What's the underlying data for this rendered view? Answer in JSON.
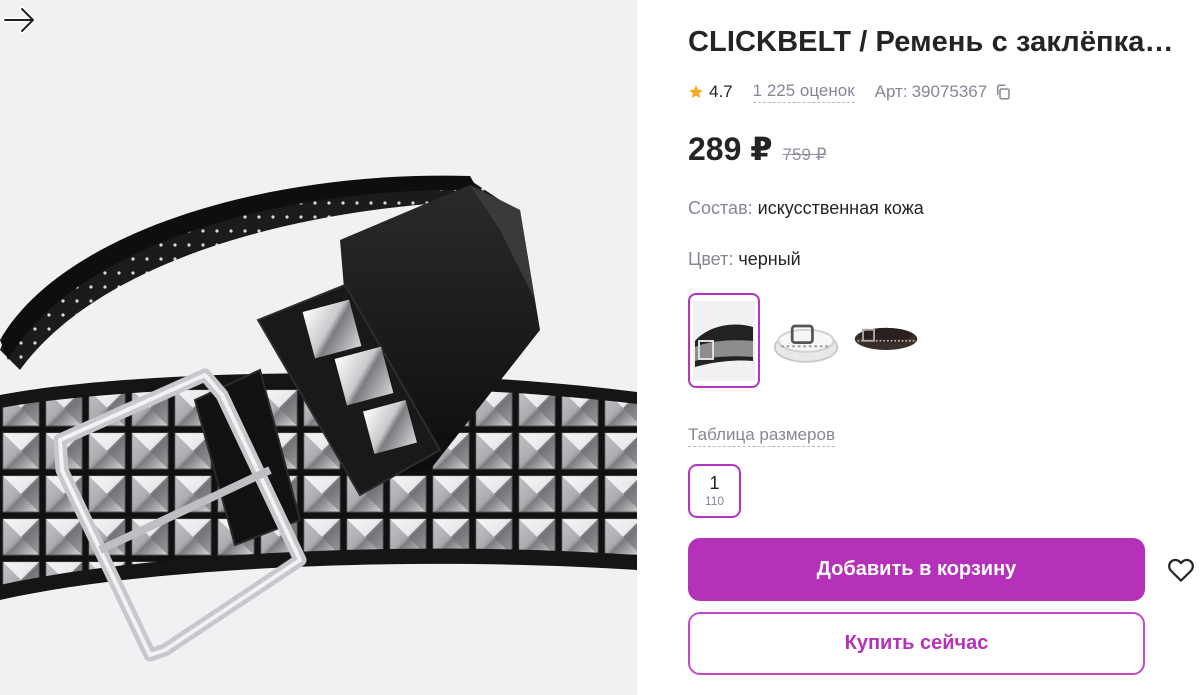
{
  "product": {
    "title": "CLICKBELT / Ремень с заклёпкам...",
    "rating": "4.7",
    "reviews": "1 225 оценок",
    "article_label": "Арт:",
    "article_value": "39075367",
    "price_current": "289 ₽",
    "price_old": "759 ₽"
  },
  "attributes": {
    "composition_label": "Состав:",
    "composition_value": "искусственная кожа",
    "color_label": "Цвет:",
    "color_value": "черный"
  },
  "color_options": [
    {
      "name": "черный",
      "selected": true
    },
    {
      "name": "белый",
      "selected": false
    },
    {
      "name": "коричневый",
      "selected": false
    }
  ],
  "sizes": {
    "table_link": "Таблица размеров",
    "options": [
      {
        "label": "1",
        "sub": "110",
        "selected": true
      }
    ]
  },
  "actions": {
    "add_to_cart": "Добавить в корзину",
    "buy_now": "Купить сейчас"
  },
  "icons": {
    "rating": "star-icon",
    "copy": "copy-icon",
    "favorite": "heart-icon",
    "gallery_next": "arrow-right-icon"
  },
  "colors": {
    "accent": "#b531b9",
    "star": "#f5a623",
    "muted_text": "#868695",
    "image_background": "#f1f1f3"
  }
}
